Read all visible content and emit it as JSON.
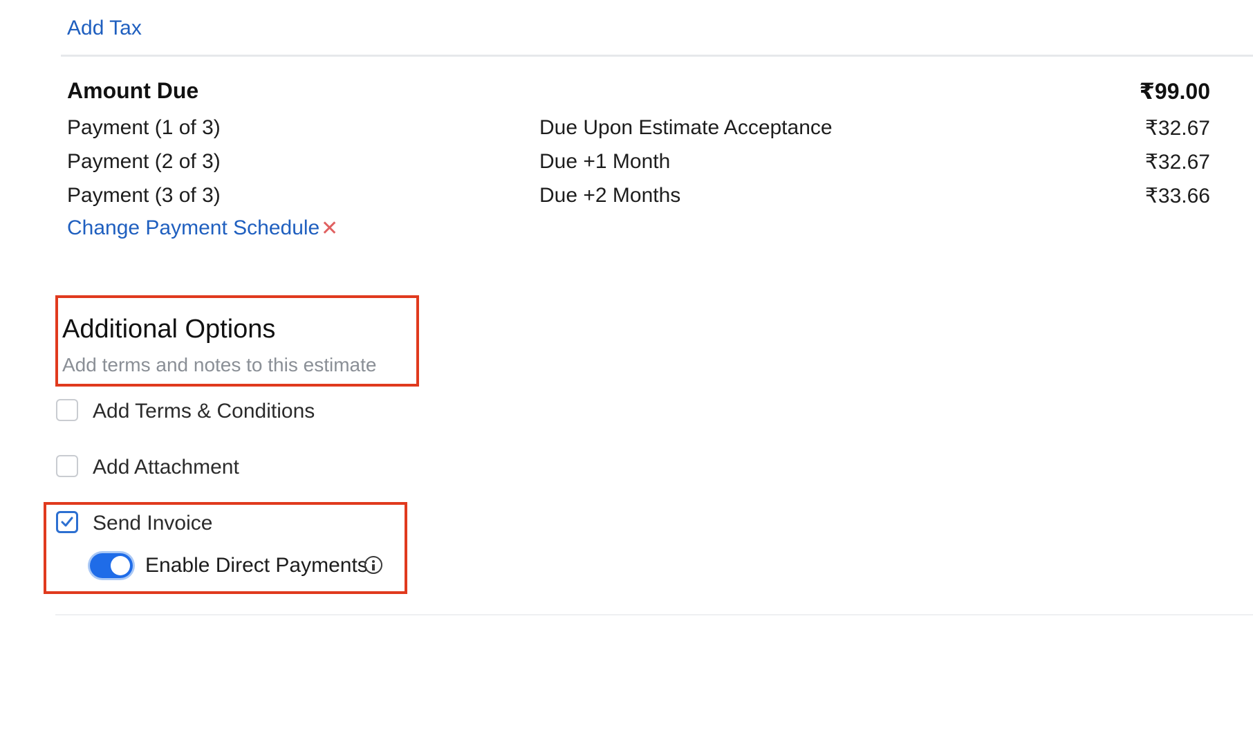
{
  "tax": {
    "add_tax_label": "Add Tax"
  },
  "amount_due": {
    "label": "Amount Due",
    "total": "₹99.00",
    "payments": [
      {
        "label": "Payment (1 of 3)",
        "due": "Due Upon Estimate Acceptance",
        "amount": "₹32.67"
      },
      {
        "label": "Payment (2 of 3)",
        "due": "Due +1 Month",
        "amount": "₹32.67"
      },
      {
        "label": "Payment (3 of 3)",
        "due": "Due +2 Months",
        "amount": "₹33.66"
      }
    ],
    "change_schedule_label": "Change Payment Schedule",
    "remove_schedule_glyph": "✕"
  },
  "additional_options": {
    "title": "Additional Options",
    "subtitle": "Add terms and notes to this estimate",
    "options": [
      {
        "label": "Add Terms & Conditions",
        "checked": false
      },
      {
        "label": "Add Attachment",
        "checked": false
      },
      {
        "label": "Send Invoice",
        "checked": true
      }
    ],
    "direct_payments": {
      "label": "Enable Direct Payments",
      "enabled": true
    }
  },
  "colors": {
    "link": "#1f5fbf",
    "highlight_border": "#e03a1e",
    "toggle_on": "#1f6ce8",
    "remove_x": "#e06060"
  },
  "icons": {
    "remove": "close-icon",
    "check": "check-icon",
    "info": "info-icon"
  }
}
